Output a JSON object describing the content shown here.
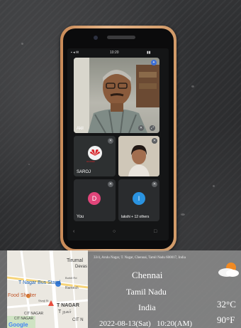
{
  "call": {
    "status_time": "10:20",
    "main_tile_name": "Akil",
    "tile_saroj_name": "SAROJ",
    "tile_saroj_logo_text": "HUAWEI",
    "tile_you_avatar": "D",
    "tile_you_name": "You",
    "tile_others_avatar": "l",
    "tile_others_name": "lakshi + 12 others",
    "avatar_you_color": "#e2457a",
    "avatar_others_color": "#2a93e0"
  },
  "geotag": {
    "address": "33/4, Arulu Nagar, T. Nagar, Chennai, Tamil Nadu 600017, India",
    "city": "Chennai",
    "state": "Tamil Nadu",
    "country": "India",
    "datetime": "2022-08-13(Sat)   10:20(AM)",
    "temp_c": "32°C",
    "temp_f": "90°F"
  },
  "map": {
    "labels": {
      "tirumal": "Tirumal",
      "deva": "Devas",
      "bus_stand": "T Nagar Bus Stand",
      "burkit": "Burkit Rd",
      "ramesh": "Ramesh",
      "food_shelter": "Food Shelter",
      "sivaji": "Sivaji St",
      "tnagar": "T NAGAR",
      "tnagar_ta": "T நகர்",
      "cit_nagar": "CIT NAGAR",
      "cit_nagar2": "CIT NAGAR",
      "cit": "CIT N",
      "google": "Google"
    }
  }
}
